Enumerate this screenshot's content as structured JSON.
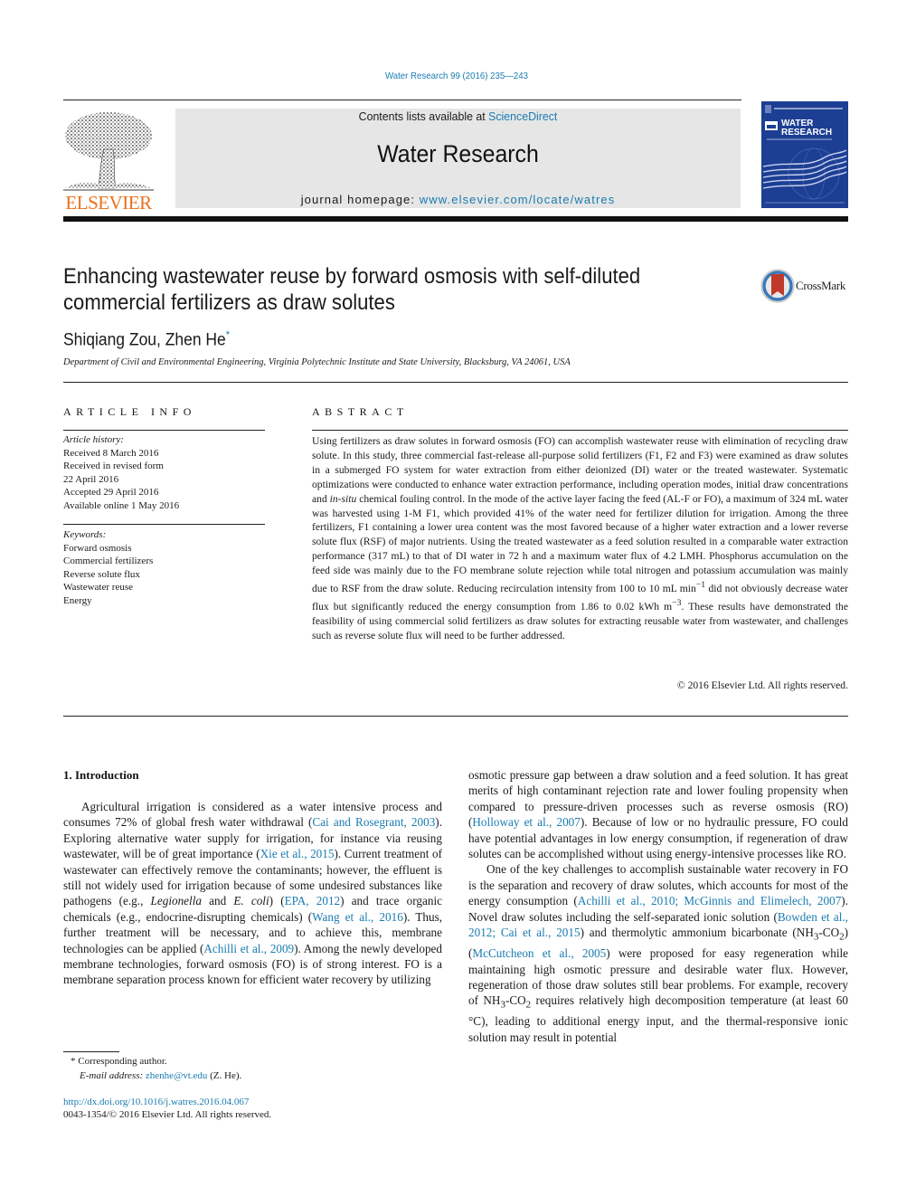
{
  "header": {
    "journal_ref": "Water Research 99 (2016) 235—243",
    "contents_prefix": "Contents lists available at ",
    "contents_link": "ScienceDirect",
    "journal_name": "Water Research",
    "homepage_prefix": "journal homepage: ",
    "homepage_link": "www.elsevier.com/locate/watres",
    "publisher_wordmark": "ELSEVIER",
    "cover_title_line1": "WATER",
    "cover_title_line2": "RESEARCH",
    "crossmark_label": "CrossMark"
  },
  "colors": {
    "link": "#1a7bb0",
    "elsevier_orange": "#e9711c",
    "cover_blue": "#1d3f93",
    "header_box_gray": "#e6e6e6"
  },
  "article": {
    "title": "Enhancing wastewater reuse by forward osmosis with self-diluted commercial fertilizers as draw solutes",
    "authors": "Shiqiang Zou, Zhen He",
    "corresponding_mark": "*",
    "affiliation": "Department of Civil and Environmental Engineering, Virginia Polytechnic Institute and State University, Blacksburg, VA 24061, USA"
  },
  "article_info": {
    "heading": "ARTICLE INFO",
    "history_label": "Article history:",
    "history": [
      "Received 8 March 2016",
      "Received in revised form",
      "22 April 2016",
      "Accepted 29 April 2016",
      "Available online 1 May 2016"
    ],
    "keywords_label": "Keywords:",
    "keywords": [
      "Forward osmosis",
      "Commercial fertilizers",
      "Reverse solute flux",
      "Wastewater reuse",
      "Energy"
    ]
  },
  "abstract": {
    "heading": "ABSTRACT",
    "p1": "Using fertilizers as draw solutes in forward osmosis (FO) can accomplish wastewater reuse with elimi­nation of recycling draw solute. In this study, three commercial fast-release all-purpose solid fertilizers (F1, F2 and F3) were examined as draw solutes in a submerged FO system for water extraction from either deionized (DI) water or the treated wastewater. Systematic optimizations were conducted to enhance water extraction performance, including operation modes, initial draw concentrations and ",
    "p1_italic": "in-situ",
    "p2": " chemical fouling control. In the mode of the active layer facing the feed (AL-F or FO), a maximum of 324 mL water was harvested using 1-M F1, which provided 41% of the water need for fertilizer dilution for irrigation. Among the three fertilizers, F1 containing a lower urea content was the most favored because of a higher water extraction and a lower reverse solute flux (RSF) of major nutrients. Using the treated wastewater as a feed solution resulted in a comparable water extraction performance (317 mL) to that of DI water in 72 h and a maximum water flux of 4.2 LMH. Phosphorus accumulation on the feed side was mainly due to the FO membrane solute rejection while total nitrogen and potassium accumulation was mainly due to RSF from the draw solute. Reducing recirculation intensity from 100 to 10 mL min",
    "sup1": "−1",
    "p3": " did not obviously decrease water flux but significantly reduced the energy consumption from 1.86 to 0.02 kWh m",
    "sup2": "−3",
    "p4": ". These results have demonstrated the feasibility of using commercial solid fertilizers as draw solutes for extracting reusable water from wastewater, and challenges such as reverse solute flux will need to be further addressed.",
    "copyright": "© 2016 Elsevier Ltd. All rights reserved."
  },
  "introduction": {
    "heading": "1.  Introduction",
    "left": {
      "t1": "Agricultural irrigation is considered as a water intensive process and consumes 72% of global fresh water withdrawal (",
      "c1": "Cai and Rosegrant, 2003",
      "t2": "). Exploring alternative water supply for irriga­tion, for instance via reusing wastewater, will be of great impor­tance (",
      "c2": "Xie et al., 2015",
      "t3": "). Current treatment of wastewater can effectively remove the contaminants; however, the effluent is still not widely used for irrigation because of some undesired sub­stances like pathogens (e.g., ",
      "i1": "Legionella",
      "t4": " and ",
      "i2": "E. coli",
      "t5": ") (",
      "c3": "EPA, 2012",
      "t6": ") and trace organic chemicals (e.g., endocrine-disrupting chemicals) (",
      "c4": "Wang et al., 2016",
      "t7": "). Thus, further treatment will be necessary, and to achieve this, membrane technologies can be applied (",
      "c5": "Achilli et al., 2009",
      "t8": "). Among the newly developed membrane technolo­gies, forward osmosis (FO) is of strong interest. FO is a membrane separation process known for efficient water recovery by utilizing"
    },
    "right": {
      "t1": "osmotic pressure gap between a draw solution and a feed solution. It has great merits of high contaminant rejection rate and lower fouling propensity when compared to pressure-driven processes such as reverse osmosis (RO) (",
      "c1": "Holloway et al., 2007",
      "t2": "). Because of low or no hydraulic pressure, FO could have potential advantages in low energy consumption, if regeneration of draw solutes can be accomplished without using energy-intensive processes like RO.",
      "p2_t1": "One of the key challenges to accomplish sustainable water re­covery in FO is the separation and recovery of draw solutes, which accounts for most of the energy consumption (",
      "p2_c1": "Achilli et al., 2010; McGinnis and Elimelech, 2007",
      "p2_t2": "). Novel draw solutes including the self-separated ionic solution (",
      "p2_c2": "Bowden et al., 2012; Cai et al., 2015",
      "p2_t3": ") and thermolytic ammonium bicarbonate (NH",
      "sub3": "3",
      "dash_co": "-CO",
      "sub2": "2",
      "p2_t4": ") (",
      "p2_c3": "McCutcheon et al., 2005",
      "p2_t5": ") were proposed for easy regeneration while maintain­ing high osmotic pressure and desirable water flux. However, regeneration of those draw solutes still bear problems. For example, recovery of NH",
      "p2_t6": " requires relatively high decomposition tem­perature (at least 60 °C), leading to additional energy input, and the thermal-responsive ionic solution may result in potential"
    }
  },
  "footnotes": {
    "mark": "*",
    "corresponding": " Corresponding author.",
    "email_label": "E-mail address:",
    "email": "zhenhe@vt.edu",
    "email_suffix": " (Z. He).",
    "doi": "http://dx.doi.org/10.1016/j.watres.2016.04.067",
    "issn": "0043-1354/© 2016 Elsevier Ltd. All rights reserved."
  }
}
